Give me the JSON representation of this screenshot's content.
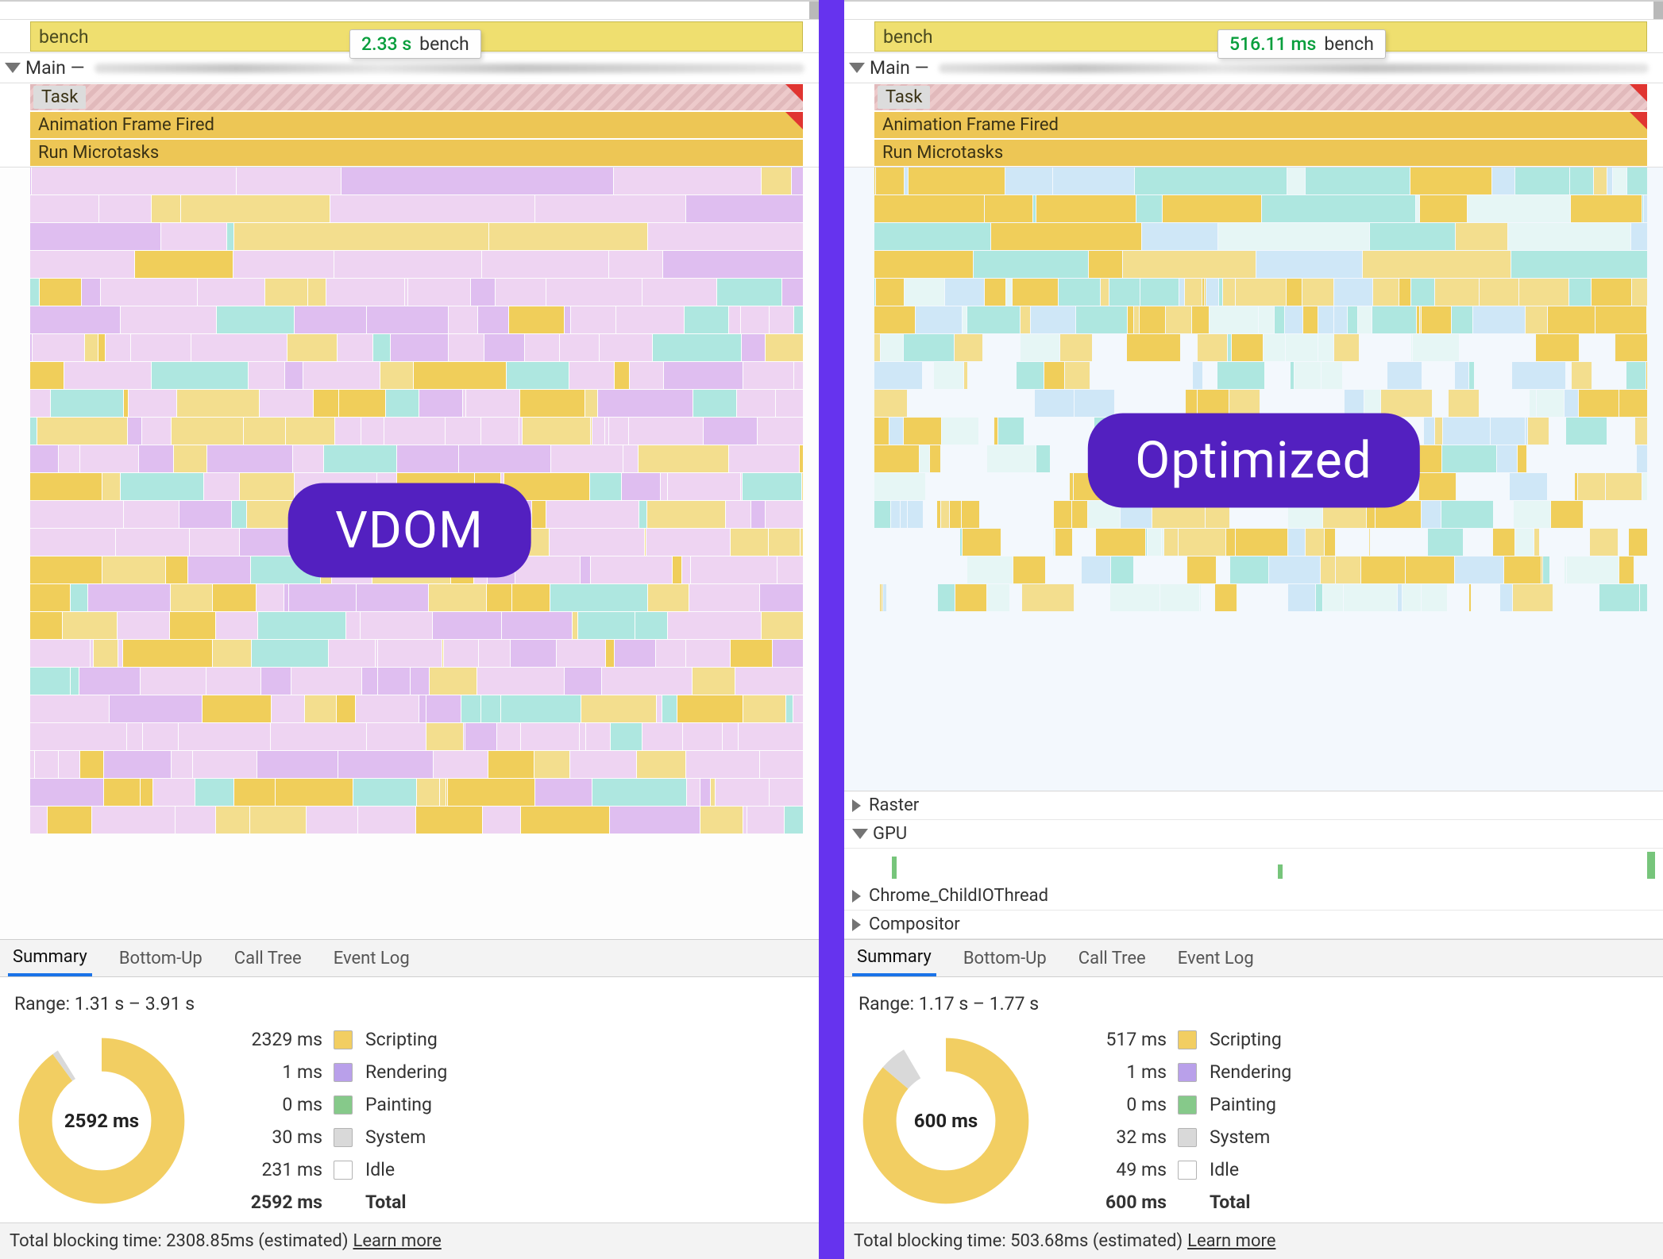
{
  "left": {
    "pill": "VDOM",
    "bench": "bench",
    "main_label": "Main —",
    "tooltip_time": "2.33 s",
    "tooltip_label": "bench",
    "events": {
      "task": "Task",
      "af": "Animation Frame Fired",
      "rm": "Run Microtasks"
    },
    "tabs": [
      "Summary",
      "Bottom-Up",
      "Call Tree",
      "Event Log"
    ],
    "range": "Range: 1.31 s – 3.91 s",
    "donut_total": "2592 ms",
    "legend": {
      "scripting": {
        "ms": "2329 ms",
        "label": "Scripting"
      },
      "rendering": {
        "ms": "1 ms",
        "label": "Rendering"
      },
      "painting": {
        "ms": "0 ms",
        "label": "Painting"
      },
      "system": {
        "ms": "30 ms",
        "label": "System"
      },
      "idle": {
        "ms": "231 ms",
        "label": "Idle"
      },
      "total": {
        "ms": "2592 ms",
        "label": "Total"
      }
    },
    "footer": {
      "text": "Total blocking time: 2308.85ms (estimated)",
      "link": "Learn more"
    },
    "chart_data": {
      "type": "pie",
      "title": "Time breakdown",
      "series": [
        {
          "name": "breakdown",
          "values": [
            {
              "label": "Scripting",
              "value": 2329,
              "color": "#f2ce62"
            },
            {
              "label": "Rendering",
              "value": 1,
              "color": "#b9a0ea"
            },
            {
              "label": "Painting",
              "value": 0,
              "color": "#86c98a"
            },
            {
              "label": "System",
              "value": 30,
              "color": "#d9d9d9"
            },
            {
              "label": "Idle",
              "value": 231,
              "color": "#ffffff"
            }
          ]
        }
      ],
      "total": 2592,
      "unit": "ms"
    }
  },
  "right": {
    "pill": "Optimized",
    "bench": "bench",
    "main_label": "Main —",
    "tooltip_time": "516.11 ms",
    "tooltip_label": "bench",
    "events": {
      "task": "Task",
      "af": "Animation Frame Fired",
      "rm": "Run Microtasks"
    },
    "threads": {
      "raster": "Raster",
      "gpu": "GPU",
      "child": "Chrome_ChildIOThread",
      "comp": "Compositor"
    },
    "tabs": [
      "Summary",
      "Bottom-Up",
      "Call Tree",
      "Event Log"
    ],
    "range": "Range: 1.17 s – 1.77 s",
    "donut_total": "600 ms",
    "legend": {
      "scripting": {
        "ms": "517 ms",
        "label": "Scripting"
      },
      "rendering": {
        "ms": "1 ms",
        "label": "Rendering"
      },
      "painting": {
        "ms": "0 ms",
        "label": "Painting"
      },
      "system": {
        "ms": "32 ms",
        "label": "System"
      },
      "idle": {
        "ms": "49 ms",
        "label": "Idle"
      },
      "total": {
        "ms": "600 ms",
        "label": "Total"
      }
    },
    "footer": {
      "text": "Total blocking time: 503.68ms (estimated)",
      "link": "Learn more"
    },
    "chart_data": {
      "type": "pie",
      "title": "Time breakdown",
      "series": [
        {
          "name": "breakdown",
          "values": [
            {
              "label": "Scripting",
              "value": 517,
              "color": "#f2ce62"
            },
            {
              "label": "Rendering",
              "value": 1,
              "color": "#b9a0ea"
            },
            {
              "label": "Painting",
              "value": 0,
              "color": "#86c98a"
            },
            {
              "label": "System",
              "value": 32,
              "color": "#d9d9d9"
            },
            {
              "label": "Idle",
              "value": 49,
              "color": "#ffffff"
            }
          ]
        }
      ],
      "total": 600,
      "unit": "ms"
    }
  }
}
